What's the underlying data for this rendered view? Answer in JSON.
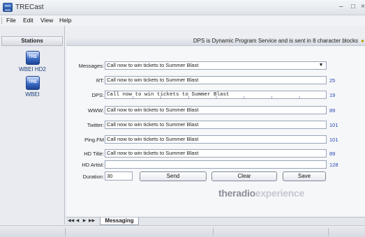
{
  "window": {
    "title": "TRECast",
    "minimize_glyph": "–",
    "maximize_glyph": "□",
    "close_glyph": "×"
  },
  "menu": {
    "items": [
      "File",
      "Edit",
      "View",
      "Help"
    ]
  },
  "stations": {
    "header": "Stations",
    "items": [
      {
        "icon_text": "TRE",
        "label": "WBEI HD2"
      },
      {
        "icon_text": "TRE",
        "label": "WBEI"
      }
    ]
  },
  "info_bar": {
    "text": "DPS is Dynamic Program Service and is sent in 8 character blocks",
    "icon": "lightbulb-icon"
  },
  "form": {
    "fields": [
      {
        "label": "Messages:",
        "value": "Call now to win tickets to Summer Blast",
        "count": "",
        "type": "dropdown"
      },
      {
        "label": "RT:",
        "value": "Call now to win tickets to Summer Blast",
        "count": "25",
        "type": "text"
      },
      {
        "label": "DPS:",
        "value": "Call now to win tickets to     Summer  Blast",
        "count": "19",
        "type": "dps"
      },
      {
        "label": "WWW:",
        "value": "Call now to win tickets to Summer Blast",
        "count": "89",
        "type": "text"
      },
      {
        "label": "Twitter:",
        "value": "Call now to win tickets to Summer Blast",
        "count": "101",
        "type": "text"
      },
      {
        "label": "Ping.FM",
        "value": "Call now to win tickets to Summer Blast",
        "count": "101",
        "type": "text"
      },
      {
        "label": "HD Title:",
        "value": "Call now to win tickets to Summer Blast",
        "count": "89",
        "type": "text"
      },
      {
        "label": "HD Artist:",
        "value": "",
        "count": "128",
        "type": "text"
      }
    ],
    "duration_label": "Duration:",
    "duration_value": "30",
    "send_label": "Send",
    "clear_label": "Clear",
    "save_label": "Save"
  },
  "brand": {
    "part1": "theradio",
    "part2": "experience"
  },
  "tabs": {
    "active": "Messaging"
  },
  "colors": {
    "count_text": "#2747b5",
    "station_label": "#1a3d7a"
  }
}
